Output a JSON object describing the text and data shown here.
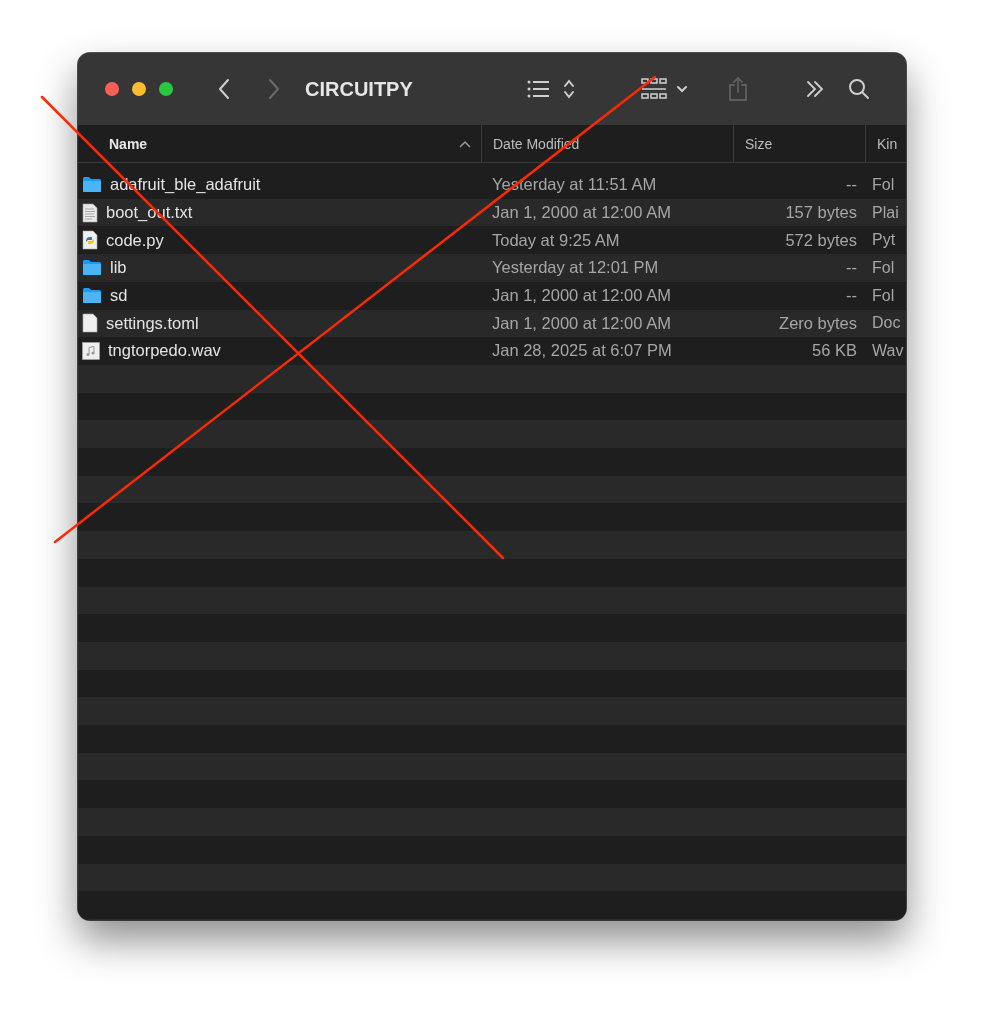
{
  "window": {
    "title": "CIRCUITPY"
  },
  "toolbar": {
    "back": {
      "disabled": false
    },
    "forward": {
      "disabled": true
    },
    "share": {
      "disabled": true
    }
  },
  "columns": [
    {
      "label": "Name",
      "sorted": true
    },
    {
      "label": "Date Modified",
      "sorted": false
    },
    {
      "label": "Size",
      "sorted": false
    },
    {
      "label": "Kin",
      "sorted": false
    }
  ],
  "files": [
    {
      "kind": "folder",
      "name": "adafruit_ble_adafruit",
      "date": "Yesterday at 11:51 AM",
      "size": "--",
      "type": "Fol"
    },
    {
      "kind": "text",
      "name": "boot_out.txt",
      "date": "Jan 1, 2000 at 12:00 AM",
      "size": "157 bytes",
      "type": "Plai"
    },
    {
      "kind": "python",
      "name": "code.py",
      "date": "Today at 9:25 AM",
      "size": "572 bytes",
      "type": "Pyt"
    },
    {
      "kind": "folder",
      "name": "lib",
      "date": "Yesterday at 12:01 PM",
      "size": "--",
      "type": "Fol"
    },
    {
      "kind": "folder",
      "name": "sd",
      "date": "Jan 1, 2000 at 12:00 AM",
      "size": "--",
      "type": "Fol"
    },
    {
      "kind": "blank",
      "name": "settings.toml",
      "date": "Jan 1, 2000 at 12:00 AM",
      "size": "Zero bytes",
      "type": "Doc"
    },
    {
      "kind": "audio",
      "name": "tngtorpedo.wav",
      "date": "Jan 28, 2025 at 6:07 PM",
      "size": "56 KB",
      "type": "Wav"
    }
  ]
}
